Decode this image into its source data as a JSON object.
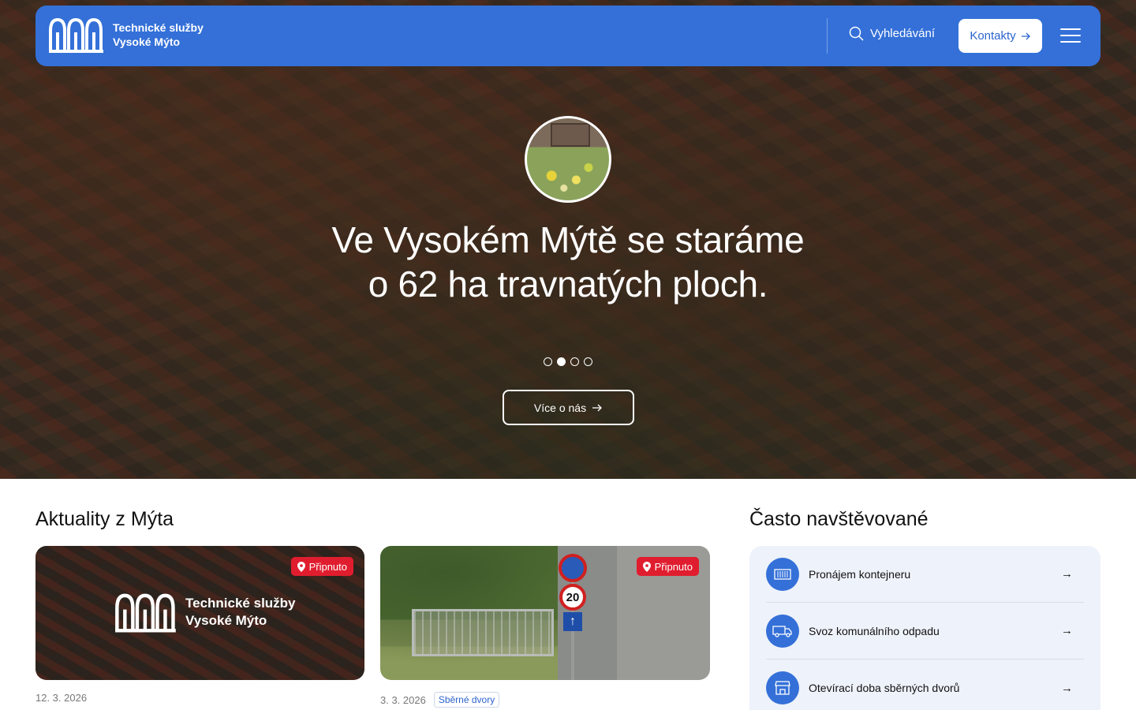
{
  "header": {
    "logo_line1": "Technické služby",
    "logo_line2": "Vysoké Mýto",
    "search_label": "Vyhledávání",
    "contact_label": "Kontakty",
    "accent_color": "#3470d8"
  },
  "hero": {
    "title_line1": "Ve Vysokém Mýtě se staráme",
    "title_line2": "o 62 ha travnatých ploch.",
    "button_label": "Více o nás",
    "slides_total": 4,
    "active_slide": 2
  },
  "news": {
    "title": "Aktuality z Mýta",
    "cards": [
      {
        "badge": "Připnuto",
        "image_logo_line1": "Technické služby",
        "image_logo_line2": "Vysoké Mýto",
        "date": "12. 3. 2026"
      },
      {
        "badge": "Připnuto",
        "sign_text": "20",
        "date": "3. 3. 2026",
        "tag": "Sběrné dvory"
      }
    ]
  },
  "frequent": {
    "title": "Často navštěvované",
    "items": [
      {
        "label": "Pronájem kontejneru",
        "icon": "container-icon"
      },
      {
        "label": "Svoz komunálního odpadu",
        "icon": "truck-icon"
      },
      {
        "label": "Otevírací doba sběrných dvorů",
        "icon": "store-icon"
      }
    ]
  },
  "colors": {
    "pin_badge": "#e01d2e",
    "light_panel": "#eef2fa"
  }
}
